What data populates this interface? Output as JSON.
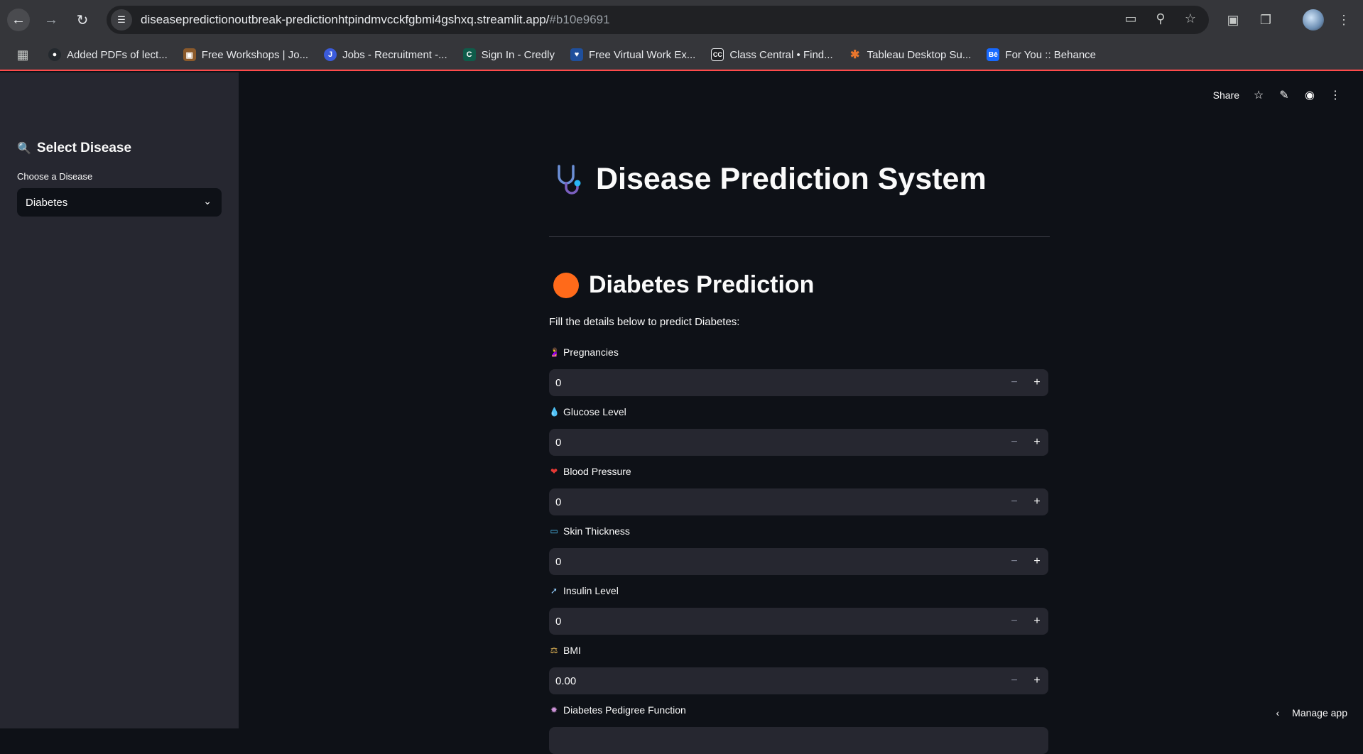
{
  "browser": {
    "url_main": "diseasepredictionoutbreak-predictionhtpindmvcckfgbmi4gshxq.streamlit.app/",
    "url_hash": "#b10e9691",
    "bookmarks": [
      {
        "label": "Added PDFs of lect...",
        "icon": "github-icon",
        "color": "#24292e"
      },
      {
        "label": "Free Workshops | Jo...",
        "icon": "briefcase-icon",
        "color": "#8b5a2b"
      },
      {
        "label": "Jobs - Recruitment -...",
        "icon": "jobs-icon",
        "color": "#3b5bdb"
      },
      {
        "label": "Sign In - Credly",
        "icon": "credly-icon",
        "color": "#0f5c4a"
      },
      {
        "label": "Free Virtual Work Ex...",
        "icon": "heart-icon",
        "color": "#1f4f9c"
      },
      {
        "label": "Class Central • Find...",
        "icon": "classcentral-icon",
        "color": "#202124"
      },
      {
        "label": "Tableau Desktop Su...",
        "icon": "tableau-icon",
        "color": "#e8762d"
      },
      {
        "label": "For You :: Behance",
        "icon": "behance-icon",
        "color": "#1769ff"
      }
    ]
  },
  "sidebar": {
    "title": "Select Disease",
    "title_icon": "magnifier-icon",
    "select_label": "Choose a Disease",
    "select_value": "Diabetes"
  },
  "toolbar": {
    "share_label": "Share"
  },
  "main": {
    "title": "Disease Prediction System",
    "subtitle": "Diabetes Prediction",
    "intro": "Fill the details below to predict Diabetes:",
    "fields": [
      {
        "label": "Pregnancies",
        "icon": "pregnant-woman-icon",
        "value": "0"
      },
      {
        "label": "Glucose Level",
        "icon": "blood-drop-icon",
        "value": "0"
      },
      {
        "label": "Blood Pressure",
        "icon": "heart-icon",
        "value": "0"
      },
      {
        "label": "Skin Thickness",
        "icon": "bandage-icon",
        "value": "0"
      },
      {
        "label": "Insulin Level",
        "icon": "syringe-icon",
        "value": "0"
      },
      {
        "label": "BMI",
        "icon": "scales-icon",
        "value": "0.00"
      },
      {
        "label": "Diabetes Pedigree Function",
        "icon": "dna-icon",
        "value": ""
      }
    ]
  },
  "footer": {
    "manage_label": "Manage app"
  },
  "colors": {
    "accent_red": "#ff4b4b",
    "orange_dot": "#ff6a1a",
    "bg": "#0e1117",
    "sidebar_bg": "#262730"
  }
}
